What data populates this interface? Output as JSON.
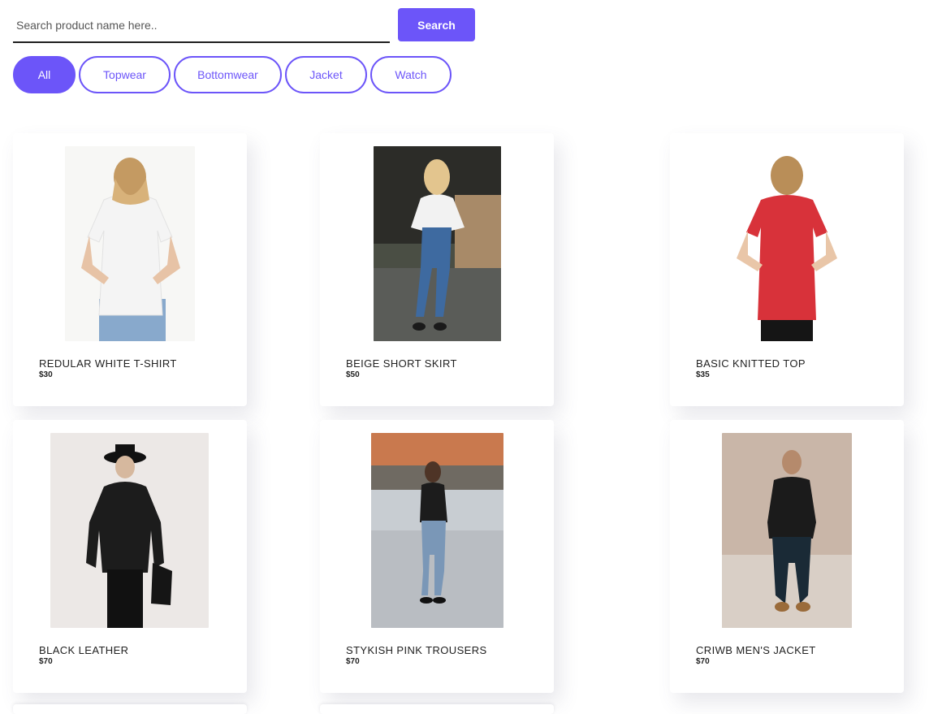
{
  "search": {
    "placeholder": "Search product name here..",
    "button_label": "Search"
  },
  "filters": [
    {
      "label": "All",
      "active": true
    },
    {
      "label": "Topwear",
      "active": false
    },
    {
      "label": "Bottomwear",
      "active": false
    },
    {
      "label": "Jacket",
      "active": false
    },
    {
      "label": "Watch",
      "active": false
    }
  ],
  "products": [
    {
      "name": "REDULAR WHITE T-SHIRT",
      "price": "$30",
      "image": "woman-white-tshirt-photo"
    },
    {
      "name": "BEIGE SHORT SKIRT",
      "price": "$50",
      "image": "woman-street-jeans-photo"
    },
    {
      "name": "BASIC KNITTED TOP",
      "price": "$35",
      "image": "woman-red-top-photo"
    },
    {
      "name": "BLACK LEATHER",
      "price": "$70",
      "image": "leather-coat-hat-photo"
    },
    {
      "name": "STYKISH PINK TROUSERS",
      "price": "$70",
      "image": "woman-plaza-jeans-photo"
    },
    {
      "name": "CRIWB MEN'S JACKET",
      "price": "$70",
      "image": "man-leather-jacket-photo"
    }
  ],
  "colors": {
    "accent": "#6c55f9",
    "text": "#222222"
  }
}
